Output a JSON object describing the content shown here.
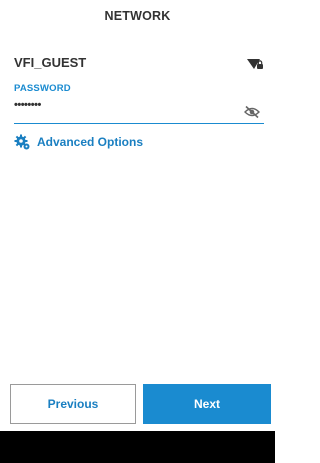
{
  "header": {
    "title": "NETWORK"
  },
  "network": {
    "ssid": "VFI_GUEST",
    "signal_icon": "wifi-lock-icon"
  },
  "password": {
    "label": "PASSWORD",
    "value": "••••••••",
    "visibility_icon": "eye-off-icon"
  },
  "advanced": {
    "label": "Advanced Options",
    "icon": "gear-icon"
  },
  "buttons": {
    "previous_label": "Previous",
    "next_label": "Next"
  },
  "colors": {
    "accent": "#1a8bd0",
    "text": "#333333",
    "bottom_bar": "#000000"
  }
}
